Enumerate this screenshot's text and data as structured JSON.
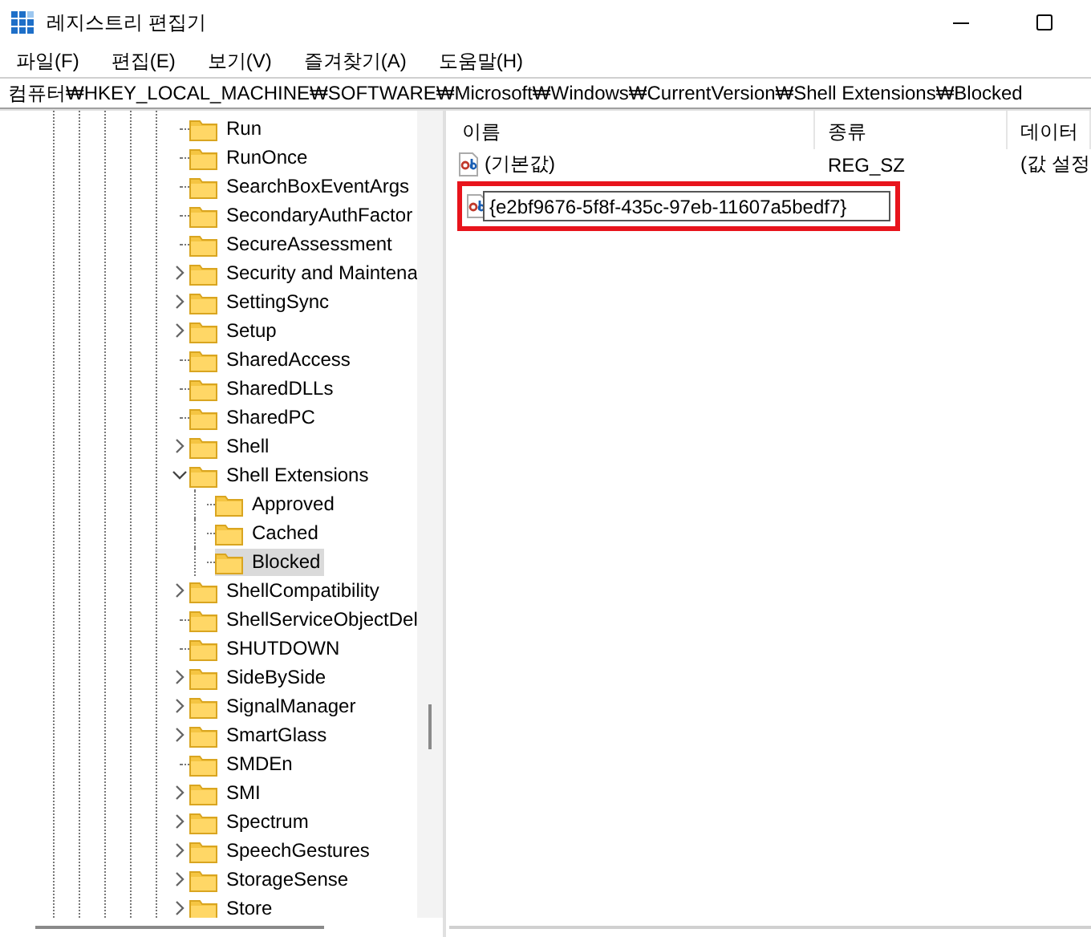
{
  "window": {
    "title": "레지스트리 편집기"
  },
  "menu": [
    "파일(F)",
    "편집(E)",
    "보기(V)",
    "즐겨찾기(A)",
    "도움말(H)"
  ],
  "address": "컴퓨터₩HKEY_LOCAL_MACHINE₩SOFTWARE₩Microsoft₩Windows₩CurrentVersion₩Shell Extensions₩Blocked",
  "tree": [
    {
      "label": "Run",
      "kind": "leaf",
      "selected": false
    },
    {
      "label": "RunOnce",
      "kind": "leaf",
      "selected": false
    },
    {
      "label": "SearchBoxEventArgs",
      "kind": "leaf",
      "selected": false
    },
    {
      "label": "SecondaryAuthFactor",
      "kind": "leaf",
      "selected": false
    },
    {
      "label": "SecureAssessment",
      "kind": "leaf",
      "selected": false
    },
    {
      "label": "Security and Maintena",
      "kind": "collapsed",
      "selected": false
    },
    {
      "label": "SettingSync",
      "kind": "collapsed",
      "selected": false
    },
    {
      "label": "Setup",
      "kind": "collapsed",
      "selected": false
    },
    {
      "label": "SharedAccess",
      "kind": "leaf",
      "selected": false
    },
    {
      "label": "SharedDLLs",
      "kind": "leaf",
      "selected": false
    },
    {
      "label": "SharedPC",
      "kind": "leaf",
      "selected": false
    },
    {
      "label": "Shell",
      "kind": "collapsed",
      "selected": false
    },
    {
      "label": "Shell Extensions",
      "kind": "expanded",
      "selected": false,
      "children": [
        {
          "label": "Approved",
          "kind": "leaf",
          "selected": false
        },
        {
          "label": "Cached",
          "kind": "leaf",
          "selected": false
        },
        {
          "label": "Blocked",
          "kind": "leaf",
          "selected": true
        }
      ]
    },
    {
      "label": "ShellCompatibility",
      "kind": "collapsed",
      "selected": false
    },
    {
      "label": "ShellServiceObjectDel",
      "kind": "leaf",
      "selected": false
    },
    {
      "label": "SHUTDOWN",
      "kind": "leaf",
      "selected": false
    },
    {
      "label": "SideBySide",
      "kind": "collapsed",
      "selected": false
    },
    {
      "label": "SignalManager",
      "kind": "collapsed",
      "selected": false
    },
    {
      "label": "SmartGlass",
      "kind": "collapsed",
      "selected": false
    },
    {
      "label": "SMDEn",
      "kind": "leaf",
      "selected": false
    },
    {
      "label": "SMI",
      "kind": "collapsed",
      "selected": false
    },
    {
      "label": "Spectrum",
      "kind": "collapsed",
      "selected": false
    },
    {
      "label": "SpeechGestures",
      "kind": "collapsed",
      "selected": false
    },
    {
      "label": "StorageSense",
      "kind": "collapsed",
      "selected": false
    },
    {
      "label": "Store",
      "kind": "collapsed",
      "selected": false
    }
  ],
  "values": {
    "columns": [
      "이름",
      "종류",
      "데이터"
    ],
    "rows": [
      {
        "kind": "static",
        "name": "(기본값)",
        "type": "REG_SZ",
        "data": "(값 설정"
      },
      {
        "kind": "editing",
        "value": "{e2bf9676-5f8f-435c-97eb-11607a5bedf7}",
        "highlighted": true
      }
    ]
  }
}
